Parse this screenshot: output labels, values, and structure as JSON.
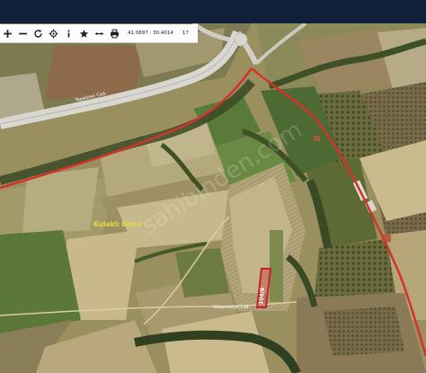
{
  "toolbar": {
    "icons": [
      "zoom-in-icon",
      "zoom-out-icon",
      "rotate-icon",
      "locate-icon",
      "info-icon",
      "star-icon",
      "measure-icon",
      "print-icon"
    ],
    "coord_lat": "41.0897",
    "coord_lon": "30.4014",
    "zoom": "17"
  },
  "map": {
    "road_label": "Tepeören Cad.",
    "area_label": "Kulaklı Dönü",
    "parcel_label": "104/9",
    "street_label": "Süleymaniye Cad.",
    "watermark": "sahibinden.com",
    "colors": {
      "boundary": "#d4322a",
      "parcel_fill": "#c8202a",
      "area_label": "#e8d84a"
    }
  }
}
